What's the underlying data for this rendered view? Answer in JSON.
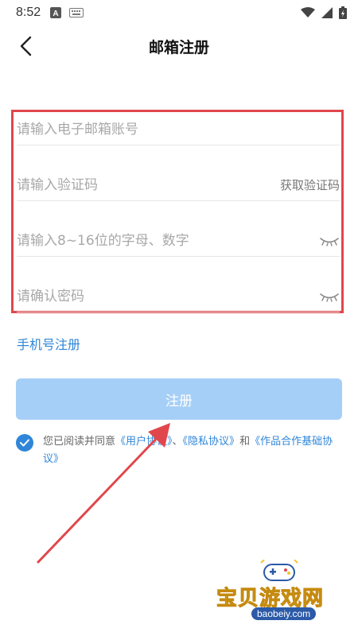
{
  "status_bar": {
    "time": "8:52",
    "icons_left": [
      "a-box-icon",
      "keyboard-icon"
    ],
    "icons_right": [
      "wifi-icon",
      "signal-icon",
      "battery-icon"
    ]
  },
  "nav": {
    "title": "邮箱注册"
  },
  "form": {
    "email_placeholder": "请输入电子邮箱账号",
    "code_placeholder": "请输入验证码",
    "get_code_label": "获取验证码",
    "password_placeholder": "请输入8~16位的字母、数字",
    "confirm_placeholder": "请确认密码"
  },
  "phone_register_label": "手机号注册",
  "register_button_label": "注册",
  "agreement": {
    "prefix": "您已阅读并同意",
    "user_agreement": "《用户协议》",
    "sep1": "、",
    "privacy_agreement": "《隐私协议》",
    "and": "和",
    "cooperation_agreement": "《作品合作基础协议》"
  },
  "watermark": {
    "text": "宝贝游戏网",
    "url": "baobeiy.com"
  },
  "colors": {
    "accent": "#2f86d8",
    "button_disabled": "#a6cff7",
    "annotation_red": "#e0474c"
  }
}
